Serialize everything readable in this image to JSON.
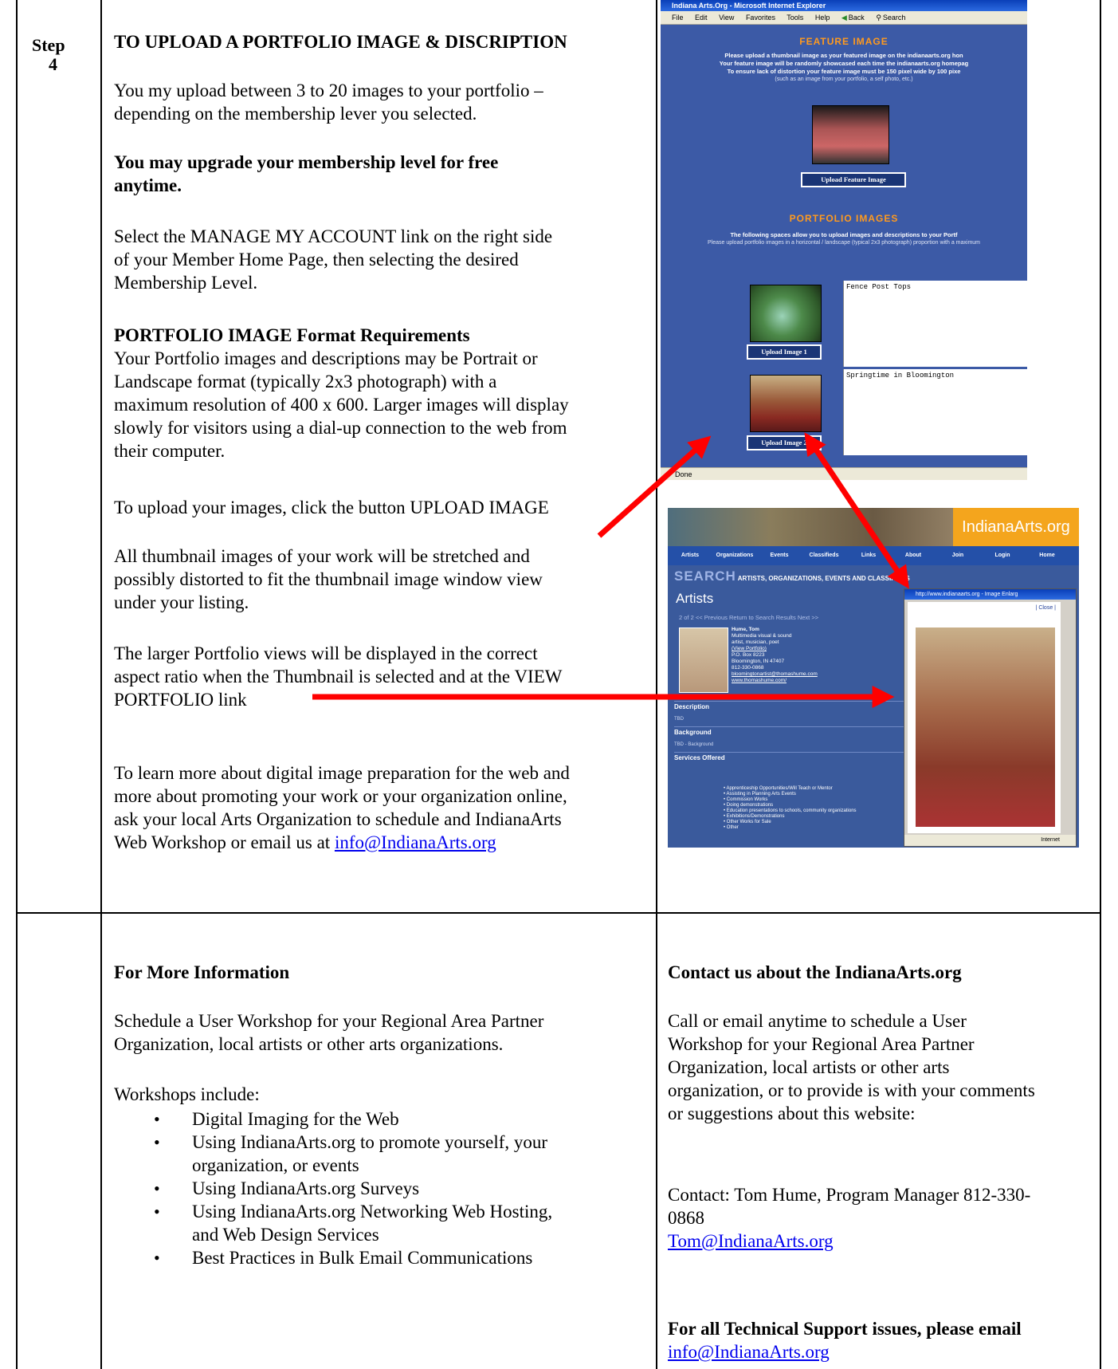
{
  "step": {
    "label": "Step",
    "number": "4"
  },
  "left": {
    "heading": "TO UPLOAD A PORTFOLIO IMAGE & DISCRIPTION",
    "p1_lines": [
      "You my upload between 3 to 20 images to your portfolio –",
      "depending on the membership lever you selected."
    ],
    "p2_lines": [
      "You may upgrade your membership level for free",
      "anytime."
    ],
    "p3_lines": [
      "Select the MANAGE MY ACCOUNT link on the right side",
      "of your Member Home Page, then selecting the desired",
      "Membership Level."
    ],
    "p4_heading": "PORTFOLIO IMAGE Format Requirements",
    "p4_lines": [
      "Your Portfolio images and descriptions may be Portrait or",
      "Landscape format (typically 2x3 photograph) with a",
      "maximum resolution of 400 x 600. Larger images will display",
      "slowly for visitors using a dial-up connection to the web from",
      "their computer."
    ],
    "p5": "To upload your images, click the button UPLOAD IMAGE",
    "p6_lines": [
      "All thumbnail images of your work will be stretched and",
      "possibly distorted to fit the thumbnail image window view",
      "under your listing."
    ],
    "p7_lines": [
      "The larger Portfolio views will be displayed in the correct",
      "aspect ratio when the Thumbnail is selected and at the VIEW",
      "PORTFOLIO link"
    ],
    "p8_lines": [
      "To learn more about digital image preparation for the web and",
      "more about promoting your work or your organization online,",
      "ask your local  Arts Organization to schedule and IndianaArts",
      "Web Workshop or email us at "
    ],
    "p8_email": "info@IndianaArts.org"
  },
  "ie_window": {
    "title": "Indiana Arts.Org - Microsoft Internet Explorer",
    "menu": [
      "File",
      "Edit",
      "View",
      "Favorites",
      "Tools",
      "Help",
      "Back",
      "Search"
    ],
    "feature_heading": "FEATURE IMAGE",
    "feature_text": [
      "Please upload a thumbnail image as your featured image on the indianaarts.org hon",
      "Your feature image will be randomly showcased each time the indianaarts.org homepag",
      "To ensure lack of distortion your feature image must be 150 pixel wide by 100 pixe"
    ],
    "feature_note": "(such as an image from your portfolio, a self photo, etc.)",
    "feature_button": "Upload Feature Image",
    "portfolio_heading": "PORTFOLIO IMAGES",
    "portfolio_text": "The following spaces allow you to upload images and descriptions to your Portf",
    "portfolio_note": "Please upload portfolio images in a horizontal / landscape (typical 2x3 photograph) proportion with a maximum",
    "image1_button": "Upload Image 1",
    "image1_desc": "Fence Post Tops",
    "image2_button": "Upload Image 2",
    "image2_desc": "Springtime in Bloomington",
    "status": "Done"
  },
  "site": {
    "brand": "IndianaArts.org",
    "nav": [
      "Artists",
      "Organizations",
      "Events",
      "Classifieds",
      "Links",
      "About",
      "Join",
      "Login",
      "Home"
    ],
    "search_title": "SEARCH",
    "search_sub": "ARTISTS, ORGANIZATIONS, EVENTS AND CLASSIFIEDS",
    "section_title": "Artists",
    "pager": "2 of 2   << Previous   Return to Search Results   Next >>",
    "person_info": [
      "Hume, Tom",
      "Multimedia visual & sound",
      "artist, musician, poet",
      "(View Portfolio)",
      "P.O. Box 8223",
      "Bloomington, IN 47407",
      "812-330-0868",
      "bloomingtonartist@thomashume.com",
      "www.thomashume.com/"
    ],
    "description_label": "Description",
    "description_value": "TBD",
    "background_label": "Background",
    "background_value": "TBD - Background",
    "services_label": "Services Offered",
    "services": [
      "Apprenticeship Opportunities/Will Teach or Mentor",
      "Assisting in Planning Arts Events",
      "Commission Works",
      "Doing demonstrations",
      "Education presentations to schools, community organizations",
      "Exhibitions/Demonstrations",
      "Other Works for Sale",
      "Other"
    ],
    "popup_title": "http://www.indianaarts.org - Image Enlarg",
    "popup_close": "| Close |",
    "popup_status": "Internet"
  },
  "bottom_left": {
    "heading": "For More Information",
    "p1_lines": [
      "Schedule a User Workshop for your Regional Area Partner",
      "Organization, local artists or other arts organizations."
    ],
    "workshops_label": "Workshops include:",
    "bullets": [
      [
        "Digital Imaging for the Web"
      ],
      [
        "Using IndianaArts.org to promote yourself, your",
        "organization, or events"
      ],
      [
        "Using IndianaArts.org Surveys"
      ],
      [
        "Using IndianaArts.org Networking Web Hosting,",
        "and Web Design Services"
      ],
      [
        "Best Practices in Bulk Email Communications"
      ]
    ]
  },
  "bottom_right": {
    "heading": "Contact us about the IndianaArts.org",
    "p1_lines": [
      "Call or email anytime to schedule a User",
      "Workshop for your Regional Area Partner",
      "Organization, local artists or other arts",
      "organization, or to provide is with your comments",
      "or suggestions about this website:"
    ],
    "contact_lines": [
      "Contact: Tom Hume, Program Manager 812-330-",
      "0868"
    ],
    "contact_email": "Tom@IndianaArts.org",
    "support_heading": "For all Technical Support issues, please email",
    "support_email": "info@IndianaArts.org"
  },
  "colors": {
    "arrow": "#ff0000",
    "link": "#0000ee",
    "brand_orange": "#f4a51d",
    "ie_blue": "#3c5aa6"
  }
}
